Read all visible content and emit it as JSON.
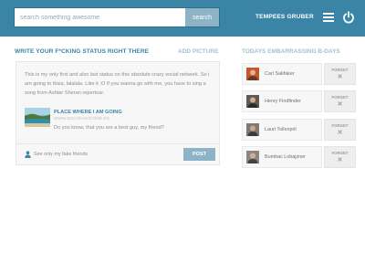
{
  "header": {
    "search_placeholder": "search something awesome",
    "search_button": "search",
    "username": "TEMPEES GRUBER",
    "icons": [
      "menu-icon",
      "power-icon"
    ]
  },
  "status": {
    "heading": "WRITE YOUR F*CKING STATUS RIGHT THERE",
    "add_picture": "ADD PICTURE",
    "text": "This is my only first and also last status on this absolute crazy social network. So i am going to Ibiza, lalalala. Like it ;O If you wanna go with me, you have to sing a song from Ashtar Sheran repertoar.",
    "place_title": "PLACE WHERE I AM GOING",
    "place_url": "WWW.BOLOHAVICOME.ES",
    "place_question": "Do you know, that you are a best guy, my friend?",
    "privacy_label": "See only my fake friends",
    "post_button": "POST"
  },
  "birthdays": {
    "heading": "TODAYS EMBARRASSING B-DAYS",
    "forget_label": "FORGET",
    "forget_mark": "✕",
    "people": [
      {
        "name": "Carl Sakfaker"
      },
      {
        "name": "Henry Findfinder"
      },
      {
        "name": "Lauri Tollenpril"
      },
      {
        "name": "Bumbac Lobajzner"
      }
    ]
  },
  "colors": {
    "header_bg": "#3a84a6",
    "accent": "#3a84a6",
    "button": "#8fb3c6",
    "muted_heading": "#9fc2d3"
  }
}
